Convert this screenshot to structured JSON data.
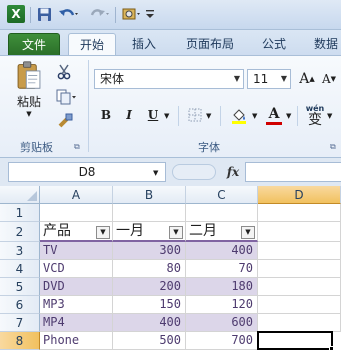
{
  "app": {
    "icon_letter": "X"
  },
  "quick_access": {
    "save": "save-icon",
    "undo": "undo-icon",
    "redo": "redo-icon",
    "customize": "customize-icon"
  },
  "tabs": [
    {
      "label": "文件"
    },
    {
      "label": "开始"
    },
    {
      "label": "插入"
    },
    {
      "label": "页面布局"
    },
    {
      "label": "公式"
    },
    {
      "label": "数据"
    }
  ],
  "ribbon": {
    "clipboard": {
      "paste_label": "粘贴",
      "group_label": "剪贴板"
    },
    "font": {
      "font_name": "宋体",
      "font_size": "11",
      "grow": "A",
      "shrink": "A",
      "bold": "B",
      "italic": "I",
      "underline": "U",
      "font_color_letter": "A",
      "phonetic": "wén",
      "phonetic_char": "变",
      "group_label": "字体"
    }
  },
  "formula_bar": {
    "name_box": "D8",
    "fx": "fx",
    "formula": ""
  },
  "sheet": {
    "columns": [
      "A",
      "B",
      "C",
      "D"
    ],
    "rows": [
      "1",
      "2",
      "3",
      "4",
      "5",
      "6",
      "7",
      "8"
    ],
    "table": {
      "headers": [
        "产品",
        "一月",
        "二月"
      ],
      "data": [
        [
          "TV",
          "300",
          "400"
        ],
        [
          "VCD",
          "80",
          "70"
        ],
        [
          "DVD",
          "200",
          "180"
        ],
        [
          "MP3",
          "150",
          "120"
        ],
        [
          "MP4",
          "400",
          "600"
        ],
        [
          "Phone",
          "500",
          "700"
        ]
      ]
    },
    "active_cell": "D8",
    "colors": {
      "band": "#dcd6e9",
      "header_border": "#8064a2",
      "text": "#4e3b6f"
    }
  }
}
